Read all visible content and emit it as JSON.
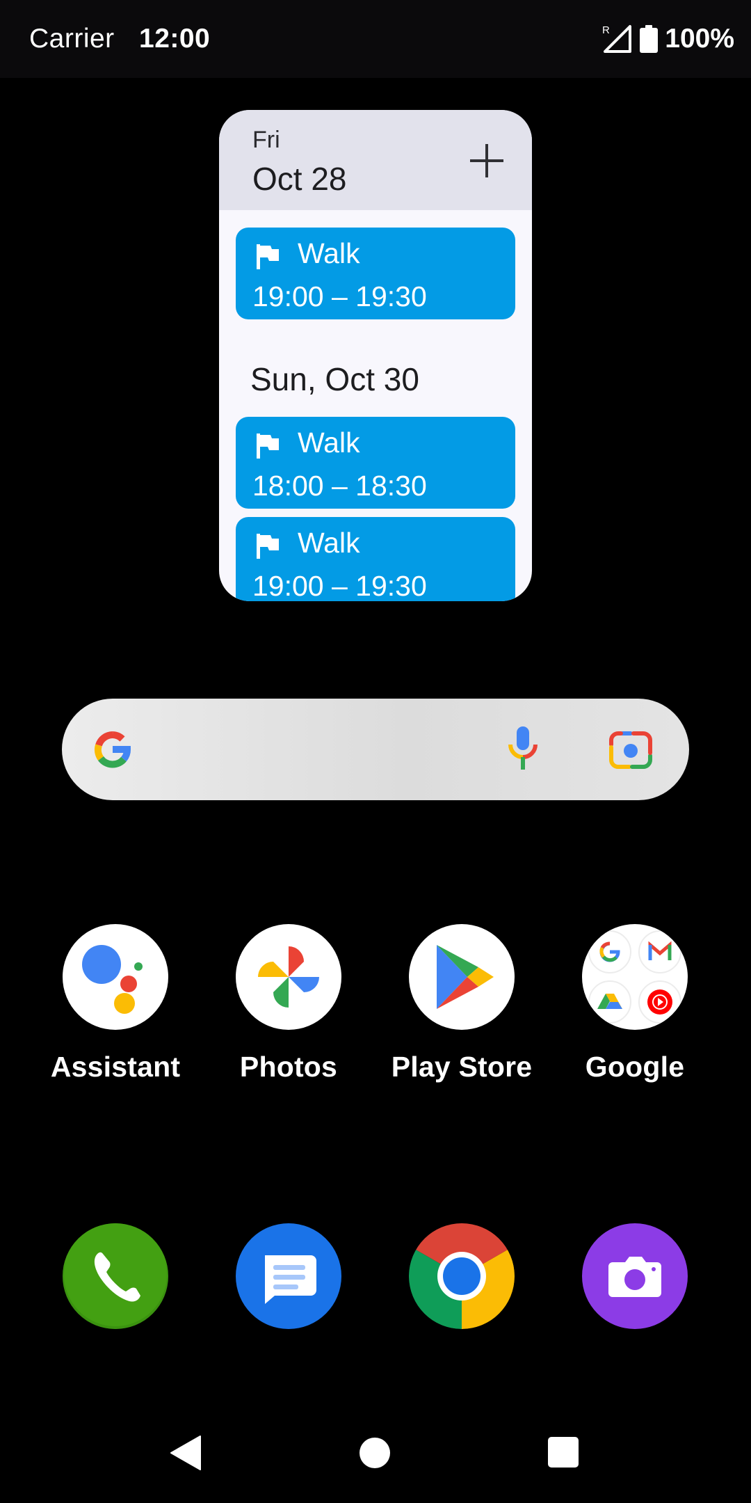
{
  "status_bar": {
    "carrier": "Carrier",
    "time": "12:00",
    "battery_percent": "100%",
    "roaming_indicator": "R"
  },
  "calendar_widget": {
    "day_of_week": "Fri",
    "date": "Oct 28",
    "add_icon": "plus-icon",
    "events": [
      {
        "title": "Walk",
        "time": "19:00 – 19:30",
        "icon": "flag-icon",
        "color": "#039be5"
      },
      {
        "title": "Walk",
        "time": "18:00 – 18:30",
        "icon": "flag-icon",
        "color": "#039be5"
      },
      {
        "title": "Walk",
        "time": "19:00 – 19:30",
        "icon": "flag-icon",
        "color": "#039be5"
      }
    ],
    "second_day_label": "Sun, Oct 30"
  },
  "search_bar": {
    "logo": "google-g-icon",
    "mic_icon": "mic-icon",
    "lens_icon": "lens-camera-icon"
  },
  "apps": [
    {
      "label": "Assistant",
      "icon": "assistant-icon"
    },
    {
      "label": "Photos",
      "icon": "photos-pinwheel-icon"
    },
    {
      "label": "Play Store",
      "icon": "play-store-icon"
    },
    {
      "label": "Google",
      "icon": "google-folder-icon"
    }
  ],
  "dock": [
    {
      "name": "phone",
      "icon": "phone-icon",
      "color": "#43a012"
    },
    {
      "name": "messages",
      "icon": "messages-icon",
      "color": "#1a73e8"
    },
    {
      "name": "chrome",
      "icon": "chrome-icon",
      "color": "#ea4335"
    },
    {
      "name": "camera",
      "icon": "camera-icon",
      "color": "#8c3ce6"
    }
  ],
  "nav_bar": {
    "back_icon": "back-triangle-icon",
    "home_icon": "home-circle-icon",
    "recents_icon": "recents-square-icon"
  }
}
